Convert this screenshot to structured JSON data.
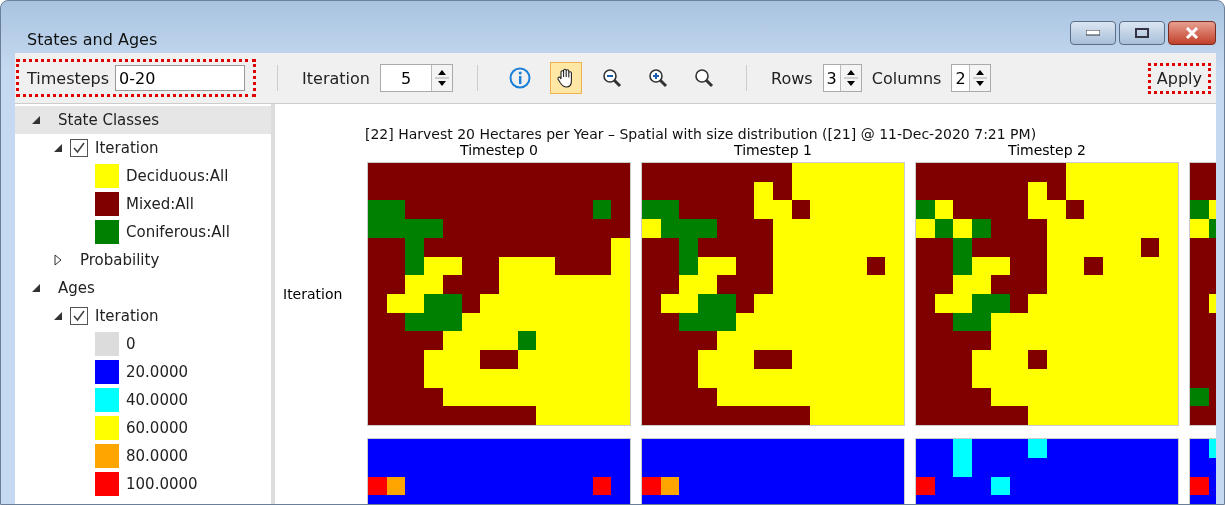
{
  "window": {
    "title": "States and Ages"
  },
  "toolbar": {
    "timesteps": {
      "label": "Timesteps",
      "value": "0-20"
    },
    "iteration": {
      "label": "Iteration",
      "value": "5"
    },
    "tools": [
      {
        "kind": "info",
        "selected": false
      },
      {
        "kind": "pan",
        "selected": true
      },
      {
        "kind": "zoom-out",
        "selected": false
      },
      {
        "kind": "zoom-in",
        "selected": false
      },
      {
        "kind": "zoom-full",
        "selected": false
      }
    ],
    "rows": {
      "label": "Rows",
      "value": "3"
    },
    "columns": {
      "label": "Columns",
      "value": "2"
    },
    "apply": "Apply"
  },
  "tree": [
    {
      "kind": "group",
      "label": "State Classes",
      "expanded": true,
      "selected": true,
      "children": [
        {
          "kind": "check",
          "label": "Iteration",
          "checked": true,
          "expanded": true,
          "selected": false,
          "children": [
            {
              "kind": "legend",
              "label": "Deciduous:All",
              "color": "#ffff00",
              "selected": false
            },
            {
              "kind": "legend",
              "label": "Mixed:All",
              "color": "#800000",
              "selected": false
            },
            {
              "kind": "legend",
              "label": "Coniferous:All",
              "color": "#008000",
              "selected": false
            }
          ]
        },
        {
          "kind": "group",
          "label": "Probability",
          "expanded": false,
          "selected": false
        }
      ]
    },
    {
      "kind": "group",
      "label": "Ages",
      "expanded": true,
      "selected": false,
      "children": [
        {
          "kind": "check",
          "label": "Iteration",
          "checked": true,
          "expanded": true,
          "selected": false,
          "children": [
            {
              "kind": "legend",
              "label": "0",
              "color": "#dcdcdc",
              "selected": false
            },
            {
              "kind": "legend",
              "label": "20.0000",
              "color": "#0000ff",
              "selected": false
            },
            {
              "kind": "legend",
              "label": "40.0000",
              "color": "#00ffff",
              "selected": false
            },
            {
              "kind": "legend",
              "label": "60.0000",
              "color": "#ffff00",
              "selected": false
            },
            {
              "kind": "legend",
              "label": "80.0000",
              "color": "#ffa500",
              "selected": false
            },
            {
              "kind": "legend",
              "label": "100.0000",
              "color": "#ff0000",
              "selected": false
            }
          ]
        }
      ]
    }
  ],
  "maps": {
    "title": "[22] Harvest 20 Hectares per Year – Spatial with size distribution ([21] @ 11-Dec-2020 7:21 PM)",
    "row_label": "Iteration",
    "columns": [
      "Timestep 0",
      "Timestep 1",
      "Timestep 2"
    ]
  }
}
